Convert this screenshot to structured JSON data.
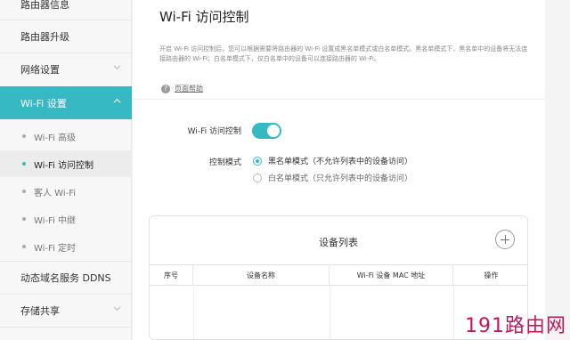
{
  "sidebar": {
    "items": [
      {
        "label": "路由器信息"
      },
      {
        "label": "路由器升级"
      },
      {
        "label": "网络设置"
      },
      {
        "label": "Wi-Fi 设置"
      },
      {
        "label": "动态域名服务 DDNS"
      },
      {
        "label": "存储共享"
      }
    ],
    "sub_items": [
      {
        "label": "Wi-Fi 高级"
      },
      {
        "label": "Wi-Fi 访问控制"
      },
      {
        "label": "客人 Wi-Fi"
      },
      {
        "label": "Wi-Fi 中继"
      },
      {
        "label": "Wi-Fi 定时"
      }
    ]
  },
  "main": {
    "title": "Wi-Fi 访问控制",
    "description": "开启 Wi-Fi 访问控制后，您可以根据需要将路由器的 Wi-Fi 设置成黑名单模式或白名单模式。黑名单模式下，黑名单中的设备将无法连接路由器的 Wi-Fi；白名单模式下，仅白名单中的设备可以连接路由器的 Wi-Fi。",
    "help_link": "页面帮助",
    "access_control_label": "Wi-Fi 访问控制",
    "access_control_enabled": true,
    "mode_label": "控制模式",
    "modes": [
      {
        "label": "黑名单模式（不允许列表中的设备访问）",
        "selected": true
      },
      {
        "label": "白名单模式（只允许列表中的设备访问）",
        "selected": false
      }
    ],
    "device_list": {
      "title": "设备列表",
      "columns": [
        "序号",
        "设备名称",
        "Wi-Fi 设备 MAC 地址",
        "操作"
      ],
      "rows": []
    }
  },
  "watermark": "191路由网",
  "colors": {
    "accent": "#37b9c4",
    "watermark": "#c2185b"
  }
}
